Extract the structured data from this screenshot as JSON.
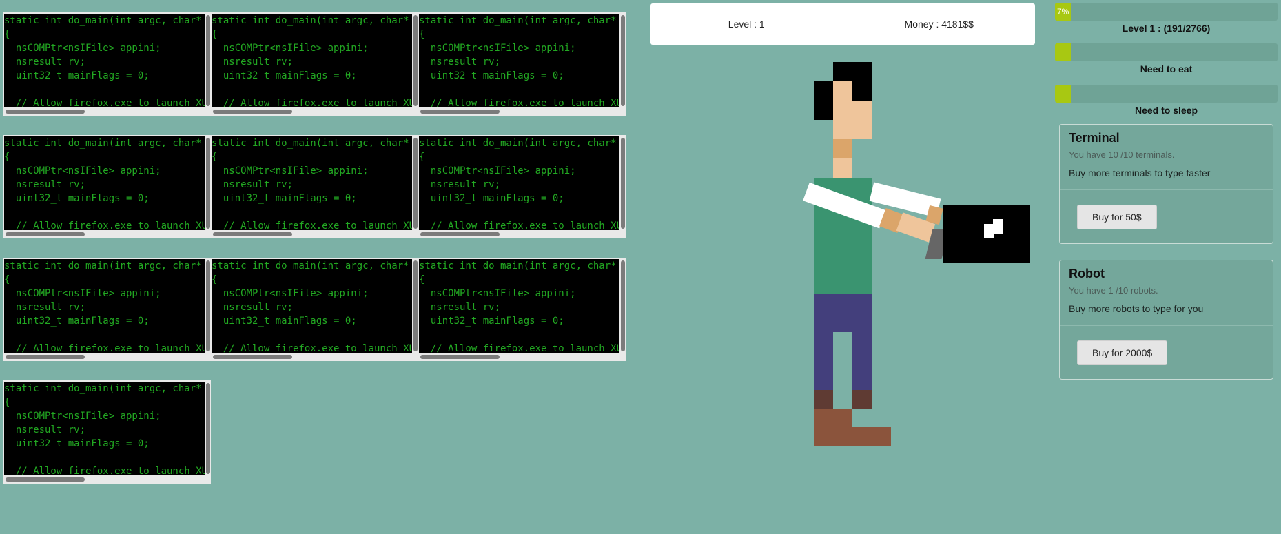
{
  "terminal": {
    "code_lines": [
      "static int do_main(int argc, char* argv[])",
      "{",
      "  nsCOMPtr<nsIFile> appini;",
      "  nsresult rv;",
      "  uint32_t mainFlags = 0;",
      "",
      "  // Allow firefox.exe to launch XULRunner apps"
    ],
    "count": 10
  },
  "status": {
    "level_label": "Level : 1",
    "money_label": "Money : 4181$$"
  },
  "progress": {
    "percent_label": "7%",
    "percent": 7,
    "caption": "Level 1 : (191/2766)"
  },
  "needs": [
    {
      "caption": "Need to eat",
      "percent": 7
    },
    {
      "caption": "Need to sleep",
      "percent": 7
    }
  ],
  "shop": {
    "terminal": {
      "title": "Terminal",
      "count": "You have 10 /10 terminals.",
      "desc": "Buy more terminals to type faster",
      "button": "Buy for 50$"
    },
    "robot": {
      "title": "Robot",
      "count": "You have 1 /10 robots.",
      "desc": "Buy more robots to type for you",
      "button": "Buy for 2000$"
    }
  },
  "colors": {
    "background": "#7cb1a6",
    "terminal_text": "#22a822",
    "progress_fill": "#a8c812",
    "shirt": "#3a9470",
    "pants": "#433f7c",
    "skin": "#efc59b",
    "shoes": "#8b543c"
  }
}
